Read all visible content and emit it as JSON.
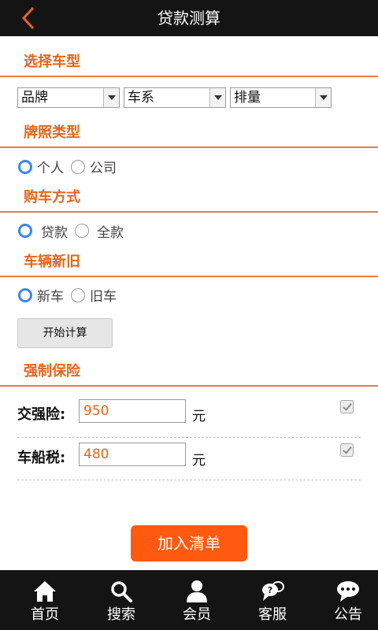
{
  "header": {
    "title": "贷款测算",
    "back_icon": "chevron-left-icon",
    "accent": "#e8641b"
  },
  "sections": {
    "car_model": "选择车型",
    "plate_type": "牌照类型",
    "purchase_method": "购车方式",
    "vehicle_condition": "车辆新旧",
    "compulsory_insurance": "强制保险"
  },
  "selects": {
    "brand": "品牌",
    "series": "车系",
    "displacement": "排量"
  },
  "plate_options": {
    "personal": "个人",
    "company": "公司",
    "selected": "personal"
  },
  "purchase_options": {
    "loan": "贷款",
    "full": "全款",
    "selected": "loan"
  },
  "condition_options": {
    "new": "新车",
    "used": "旧车",
    "selected": "new"
  },
  "calc_button": "开始计算",
  "insurance": {
    "jiaoqiang": {
      "label": "交强险:",
      "value": "950",
      "unit": "元",
      "checked": true
    },
    "chechuan": {
      "label": "车船税:",
      "value": "480",
      "unit": "元",
      "checked": true
    }
  },
  "add_button": "加入清单",
  "tabs": [
    {
      "label": "首页",
      "icon": "home-icon"
    },
    {
      "label": "搜索",
      "icon": "search-icon"
    },
    {
      "label": "会员",
      "icon": "user-icon"
    },
    {
      "label": "客服",
      "icon": "chat-icon"
    },
    {
      "label": "公告",
      "icon": "message-icon"
    }
  ]
}
